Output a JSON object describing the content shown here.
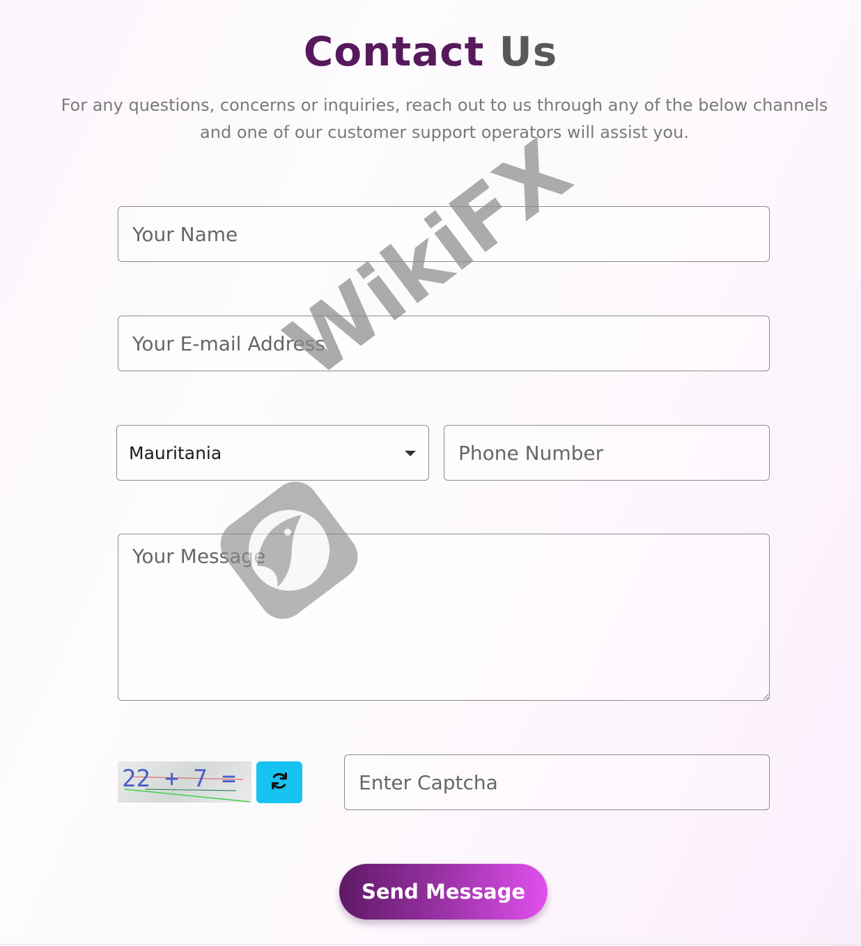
{
  "header": {
    "title_part1": "Contact",
    "title_part2": "Us",
    "subtitle_line1": "For any questions, concerns or inquiries, reach out to us through any of the below channels",
    "subtitle_line2": "and one of our customer support operators will assist you."
  },
  "form": {
    "name_placeholder": "Your Name",
    "email_placeholder": "Your E-mail Address",
    "country_selected": "Mauritania",
    "phone_placeholder": "Phone Number",
    "message_placeholder": "Your Message",
    "captcha_text": "22 + 7 =",
    "captcha_placeholder": "Enter Captcha",
    "submit_label": "Send Message"
  },
  "watermark": {
    "text": "WikiFX"
  },
  "colors": {
    "title_primary": "#561a5c",
    "title_secondary": "#595959",
    "refresh_button": "#17c3f2",
    "send_gradient_start": "#5e1a66",
    "send_gradient_end": "#e150ee"
  },
  "icons": {
    "refresh": "refresh-icon",
    "dropdown": "chevron-down-icon",
    "watermark_logo": "eagle-logo-icon"
  }
}
